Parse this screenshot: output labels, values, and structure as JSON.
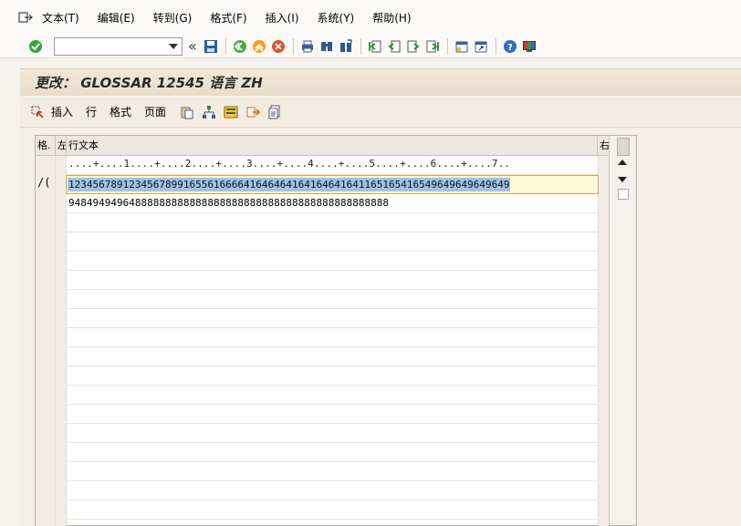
{
  "menubar": {
    "items": [
      "文本(T)",
      "编辑(E)",
      "转到(G)",
      "格式(F)",
      "插入(I)",
      "系统(Y)",
      "帮助(H)"
    ]
  },
  "toolbar": {
    "command_value": "",
    "icons": [
      "enter-icon",
      "save-icon",
      "back-icon",
      "exit-icon",
      "cancel-icon",
      "print-icon",
      "find-icon",
      "find-next-icon",
      "first-page-icon",
      "prev-page-icon",
      "next-page-icon",
      "last-page-icon",
      "create-session-icon",
      "shortcut-icon",
      "help-icon",
      "layout-icon"
    ]
  },
  "title": "更改： GLOSSAR 12545 语言 ZH",
  "apptoolbar": {
    "insert_label": "插入",
    "line_label": "行",
    "format_label": "格式",
    "page_label": "页面"
  },
  "table": {
    "headers": {
      "format": "格.",
      "left": "左",
      "text": "行文本",
      "right": "右"
    },
    "ruler": "....+....1....+....2....+....3....+....4....+....5....+....6....+....7..",
    "rows": [
      {
        "format": "/(",
        "text": "1234567891234567899165561666641646464164164641641165165416549649649649649"
      },
      {
        "format": "",
        "text": "94849494964888888888888888888888888888888888888888888"
      }
    ]
  }
}
